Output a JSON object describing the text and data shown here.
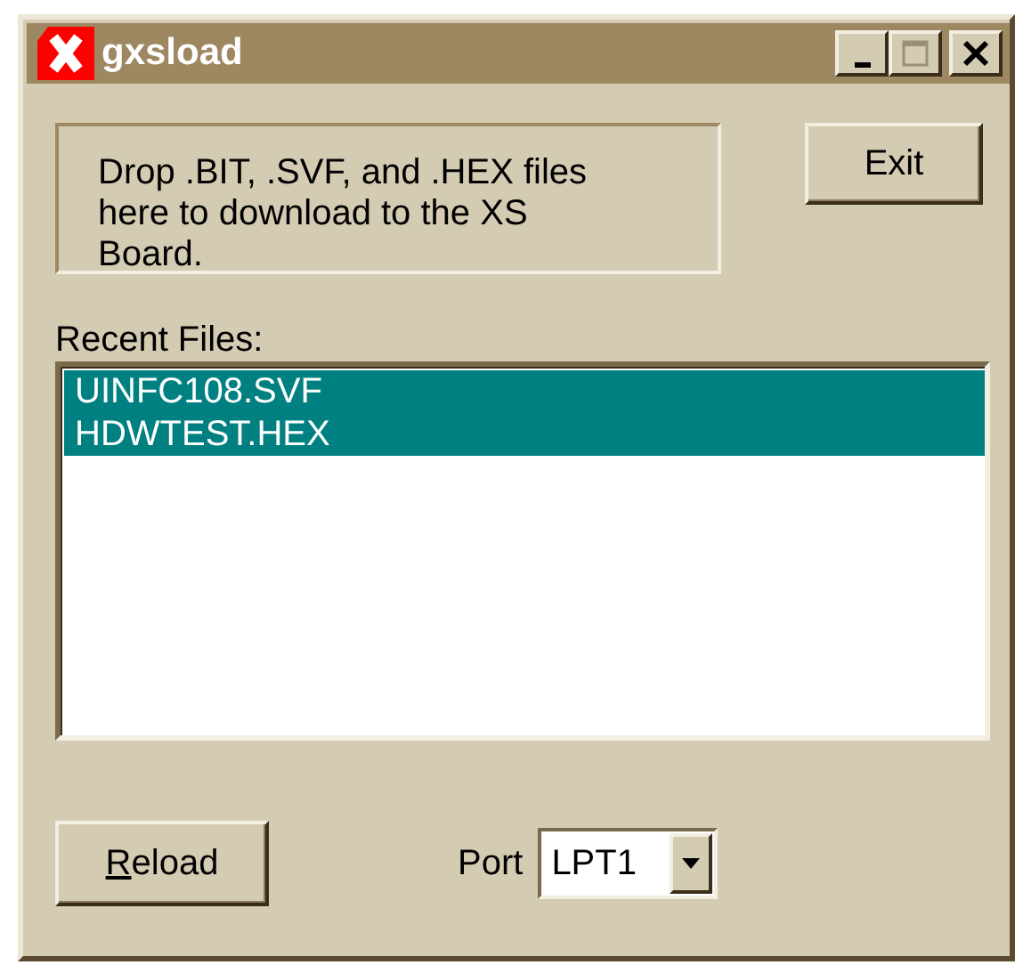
{
  "window": {
    "title": "gxsload",
    "controls": [
      {
        "kind": "minimize",
        "disabled": false
      },
      {
        "kind": "maximize",
        "disabled": true
      },
      {
        "kind": "close",
        "disabled": false
      }
    ]
  },
  "drop_area": {
    "text": "Drop .BIT, .SVF, and .HEX files here to download to the XS Board."
  },
  "exit_button": {
    "label": "Exit"
  },
  "recent_files": {
    "label": "Recent Files:",
    "items": [
      {
        "name": "UINFC108.SVF",
        "selected": true
      },
      {
        "name": "HDWTEST.HEX",
        "selected": true
      }
    ]
  },
  "reload_button": {
    "label": "Reload",
    "mnemonic_underlined": true
  },
  "port": {
    "label": "Port",
    "value": "LPT1"
  }
}
